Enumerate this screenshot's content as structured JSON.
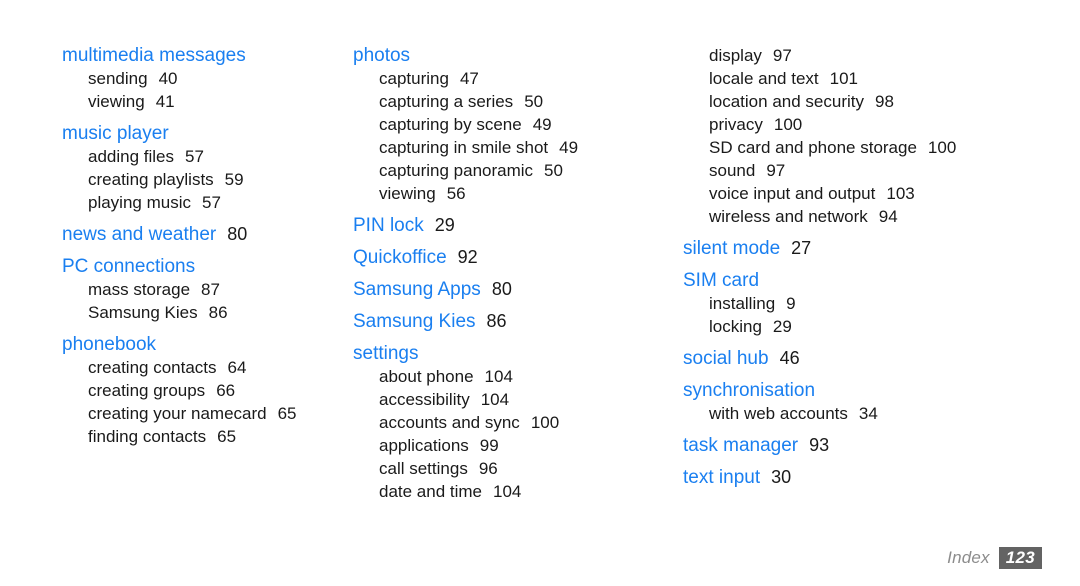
{
  "document": {
    "type": "index-page",
    "footer": {
      "label": "Index",
      "page_number": "123"
    },
    "colors": {
      "heading": "#1a7ff0",
      "body": "#1a1a1a",
      "footer_label": "#8c8c8c",
      "footer_box": "#636363",
      "background": "#ffffff"
    }
  },
  "columns": [
    {
      "id": "column-1",
      "entries": [
        {
          "level": "heading",
          "label": "multimedia messages",
          "page": ""
        },
        {
          "level": "sub",
          "label": "sending",
          "page": "40"
        },
        {
          "level": "sub",
          "label": "viewing",
          "page": "41"
        },
        {
          "level": "heading",
          "label": "music player",
          "page": ""
        },
        {
          "level": "sub",
          "label": "adding files",
          "page": "57"
        },
        {
          "level": "sub",
          "label": "creating playlists",
          "page": "59"
        },
        {
          "level": "sub",
          "label": "playing music",
          "page": "57"
        },
        {
          "level": "heading",
          "label": "news and weather",
          "page": "80"
        },
        {
          "level": "heading",
          "label": "PC connections",
          "page": ""
        },
        {
          "level": "sub",
          "label": "mass storage",
          "page": "87"
        },
        {
          "level": "sub",
          "label": "Samsung Kies",
          "page": "86"
        },
        {
          "level": "heading",
          "label": "phonebook",
          "page": ""
        },
        {
          "level": "sub",
          "label": "creating contacts",
          "page": "64"
        },
        {
          "level": "sub",
          "label": "creating groups",
          "page": "66"
        },
        {
          "level": "sub",
          "label": "creating your namecard",
          "page": "65"
        },
        {
          "level": "sub",
          "label": "finding contacts",
          "page": "65"
        }
      ]
    },
    {
      "id": "column-2",
      "entries": [
        {
          "level": "heading",
          "label": "photos",
          "page": ""
        },
        {
          "level": "sub",
          "label": "capturing",
          "page": "47"
        },
        {
          "level": "sub",
          "label": "capturing a series",
          "page": "50"
        },
        {
          "level": "sub",
          "label": "capturing by scene",
          "page": "49"
        },
        {
          "level": "sub",
          "label": "capturing in smile shot",
          "page": "49"
        },
        {
          "level": "sub",
          "label": "capturing panoramic",
          "page": "50"
        },
        {
          "level": "sub",
          "label": "viewing",
          "page": "56"
        },
        {
          "level": "heading",
          "label": "PIN lock",
          "page": "29"
        },
        {
          "level": "heading",
          "label": "Quickoffice",
          "page": "92"
        },
        {
          "level": "heading",
          "label": "Samsung Apps",
          "page": "80"
        },
        {
          "level": "heading",
          "label": "Samsung Kies",
          "page": "86"
        },
        {
          "level": "heading",
          "label": "settings",
          "page": ""
        },
        {
          "level": "sub",
          "label": "about phone",
          "page": "104"
        },
        {
          "level": "sub",
          "label": "accessibility",
          "page": "104"
        },
        {
          "level": "sub",
          "label": "accounts and sync",
          "page": "100"
        },
        {
          "level": "sub",
          "label": "applications",
          "page": "99"
        },
        {
          "level": "sub",
          "label": "call settings",
          "page": "96"
        },
        {
          "level": "sub",
          "label": "date and time",
          "page": "104"
        }
      ]
    },
    {
      "id": "column-3",
      "entries": [
        {
          "level": "sub",
          "label": "display",
          "page": "97"
        },
        {
          "level": "sub",
          "label": "locale and text",
          "page": "101"
        },
        {
          "level": "sub",
          "label": "location and security",
          "page": "98"
        },
        {
          "level": "sub",
          "label": "privacy",
          "page": "100"
        },
        {
          "level": "sub",
          "label": "SD card and phone storage",
          "page": "100"
        },
        {
          "level": "sub",
          "label": "sound",
          "page": "97"
        },
        {
          "level": "sub",
          "label": "voice input and output",
          "page": "103"
        },
        {
          "level": "sub",
          "label": "wireless and network",
          "page": "94"
        },
        {
          "level": "heading",
          "label": "silent mode",
          "page": "27"
        },
        {
          "level": "heading",
          "label": "SIM card",
          "page": ""
        },
        {
          "level": "sub",
          "label": "installing",
          "page": "9"
        },
        {
          "level": "sub",
          "label": "locking",
          "page": "29"
        },
        {
          "level": "heading",
          "label": "social hub",
          "page": "46"
        },
        {
          "level": "heading",
          "label": "synchronisation",
          "page": ""
        },
        {
          "level": "sub",
          "label": "with web accounts",
          "page": "34"
        },
        {
          "level": "heading",
          "label": "task manager",
          "page": "93"
        },
        {
          "level": "heading",
          "label": "text input",
          "page": "30"
        }
      ]
    }
  ]
}
